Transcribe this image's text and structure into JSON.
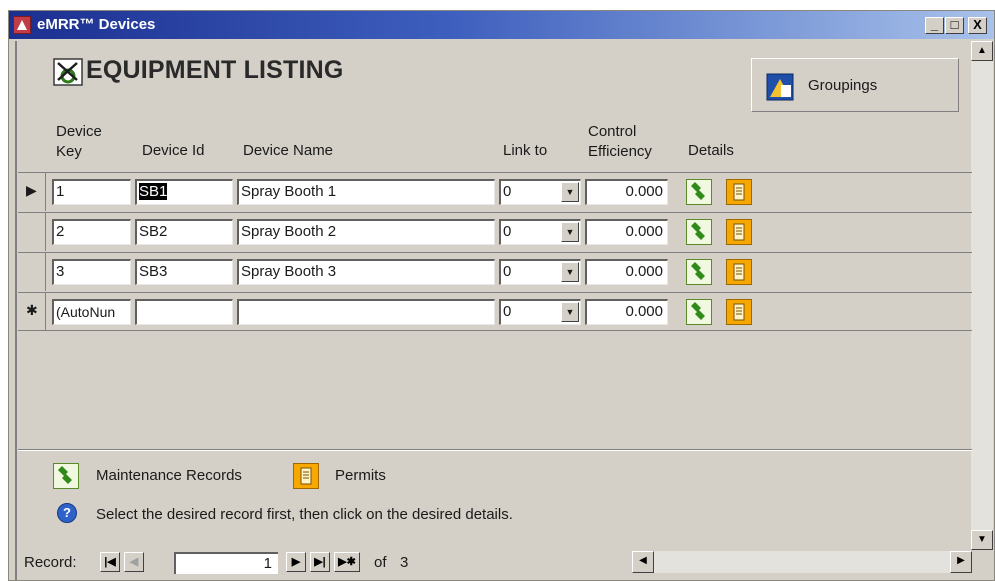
{
  "window": {
    "title": "eMRR™ Devices",
    "min": "_",
    "max": "□",
    "close": "X"
  },
  "header": {
    "title": "EQUIPMENT LISTING",
    "groupings_label": "Groupings"
  },
  "columns": {
    "device_key": "Device\nKey",
    "device_id": "Device Id",
    "device_name": "Device Name",
    "link_to": "Link to",
    "control_efficiency": "Control\nEfficiency",
    "details": "Details"
  },
  "rows": [
    {
      "selector": "▶",
      "key": "1",
      "id": "SB1",
      "name": "Spray Booth 1",
      "link": "0",
      "eff": "0.000"
    },
    {
      "selector": "",
      "key": "2",
      "id": "SB2",
      "name": "Spray Booth 2",
      "link": "0",
      "eff": "0.000"
    },
    {
      "selector": "",
      "key": "3",
      "id": "SB3",
      "name": "Spray Booth 3",
      "link": "0",
      "eff": "0.000"
    },
    {
      "selector": "✱",
      "key": "(AutoNun",
      "id": "",
      "name": "",
      "link": "0",
      "eff": "0.000"
    }
  ],
  "legend": {
    "maintenance": "Maintenance Records",
    "permits": "Permits",
    "hint": "Select the desired record first, then click on the desired details."
  },
  "nav": {
    "label": "Record:",
    "current": "1",
    "of": "of",
    "total": "3"
  },
  "colors": {
    "title_gradient_start": "#1b2f8f",
    "face": "#d4d0c8",
    "permit": "#f6a800",
    "wrench": "#2f8a1a"
  }
}
